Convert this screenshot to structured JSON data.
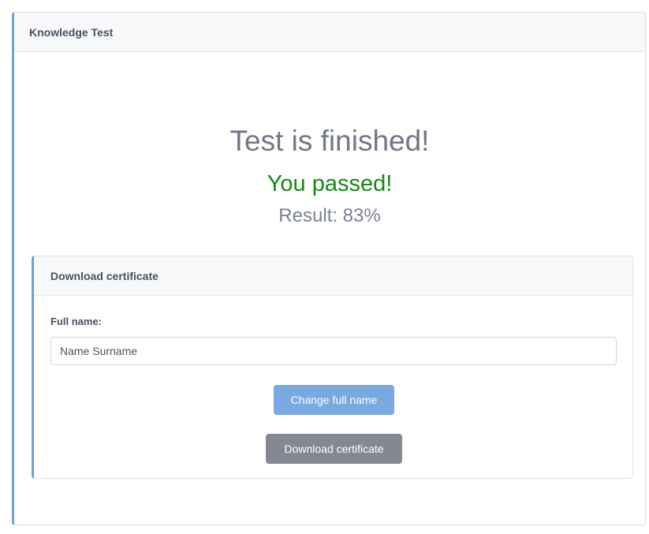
{
  "outer_card": {
    "title": "Knowledge Test"
  },
  "result": {
    "heading": "Test is finished!",
    "status": "You passed!",
    "score_label": "Result: 83%",
    "score_percent": 83
  },
  "certificate_card": {
    "title": "Download certificate",
    "full_name_label": "Full name:",
    "full_name_value": "Name Surname",
    "change_button_label": "Change full name",
    "download_button_label": "Download certificate"
  },
  "colors": {
    "accent_blue": "#78a9e0",
    "card_left_border": "#6f9fd8",
    "passed_green": "#118a11",
    "heading_gray": "#707786",
    "download_button_gray": "#848893"
  }
}
